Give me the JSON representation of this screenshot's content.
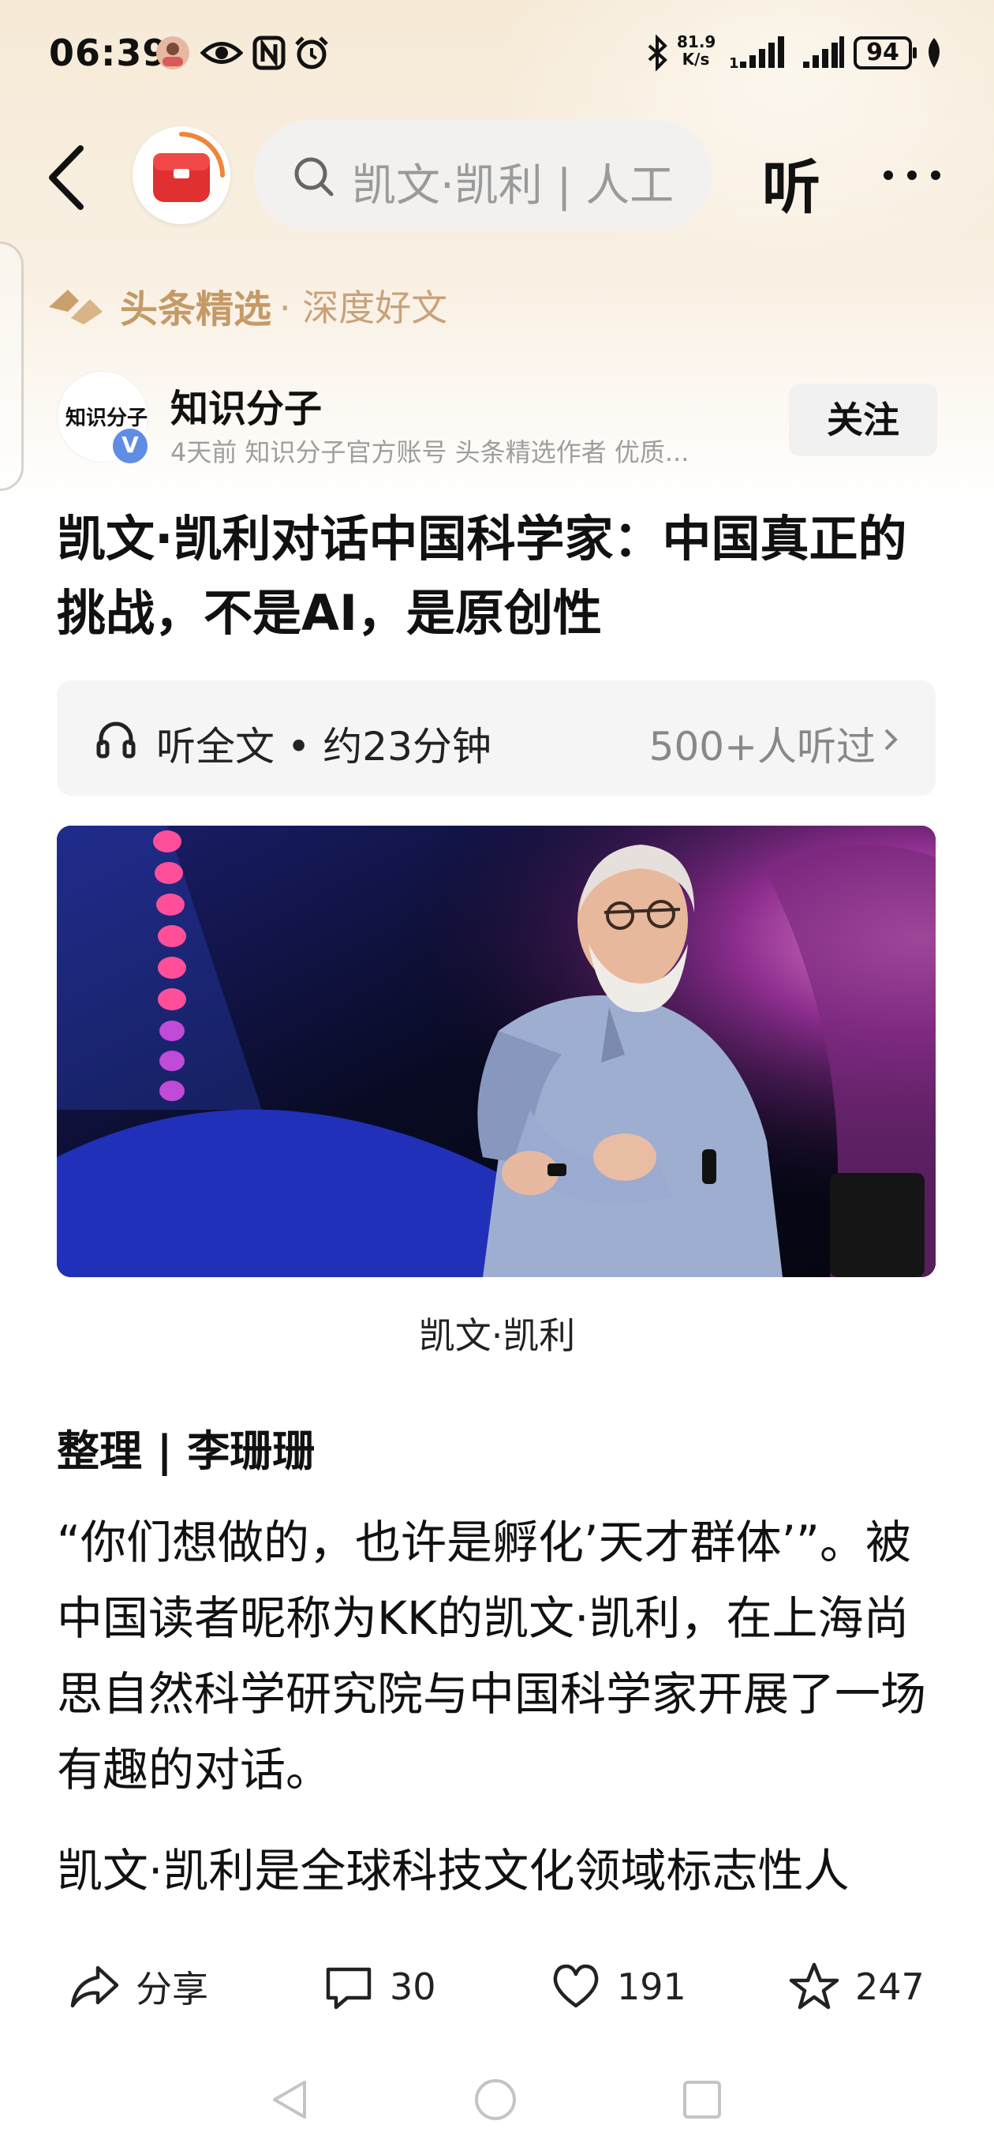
{
  "status_bar": {
    "time": "06:39",
    "net_speed_value": "81.9",
    "net_speed_unit": "K/s",
    "battery": "94",
    "icons": [
      "avatar-icon",
      "eye-icon",
      "nfc-icon",
      "alarm-icon",
      "bluetooth-icon",
      "signal-icon",
      "signal-icon",
      "battery-icon",
      "leaf-icon"
    ]
  },
  "nav": {
    "search_text": "凯文·凯利 | 人工",
    "listen_label": "听",
    "icons": [
      "back-icon",
      "app-logo-icon",
      "search-icon",
      "more-icon"
    ]
  },
  "featured": {
    "name": "头条精选",
    "sub": "· 深度好文"
  },
  "author": {
    "avatar_text": "知识分子",
    "verified_mark": "V",
    "name": "知识分子",
    "meta": "4天前  知识分子官方账号 头条精选作者 优质...",
    "follow_label": "关注"
  },
  "article": {
    "title": "凯文·凯利对话中国科学家：中国真正的挑战，不是AI，是原创性",
    "listen_card": {
      "label": "听全文 • 约23分钟",
      "count": "500+人听过"
    },
    "image_caption": "凯文·凯利",
    "editor": "整理 | 李珊珊",
    "paragraph_1": "“你们想做的，也许是孵化’天才群体’”。被中国读者昵称为KK的凯文·凯利，在上海尚思自然科学研究院与中国科学家开展了一场有趣的对话。",
    "paragraph_2": "凯文·凯利是全球科技文化领域标志性人"
  },
  "actions": {
    "share": "分享",
    "comments": "30",
    "likes": "191",
    "favorites": "247"
  },
  "system_nav": [
    "back-triangle-icon",
    "home-circle-icon",
    "recents-square-icon"
  ]
}
